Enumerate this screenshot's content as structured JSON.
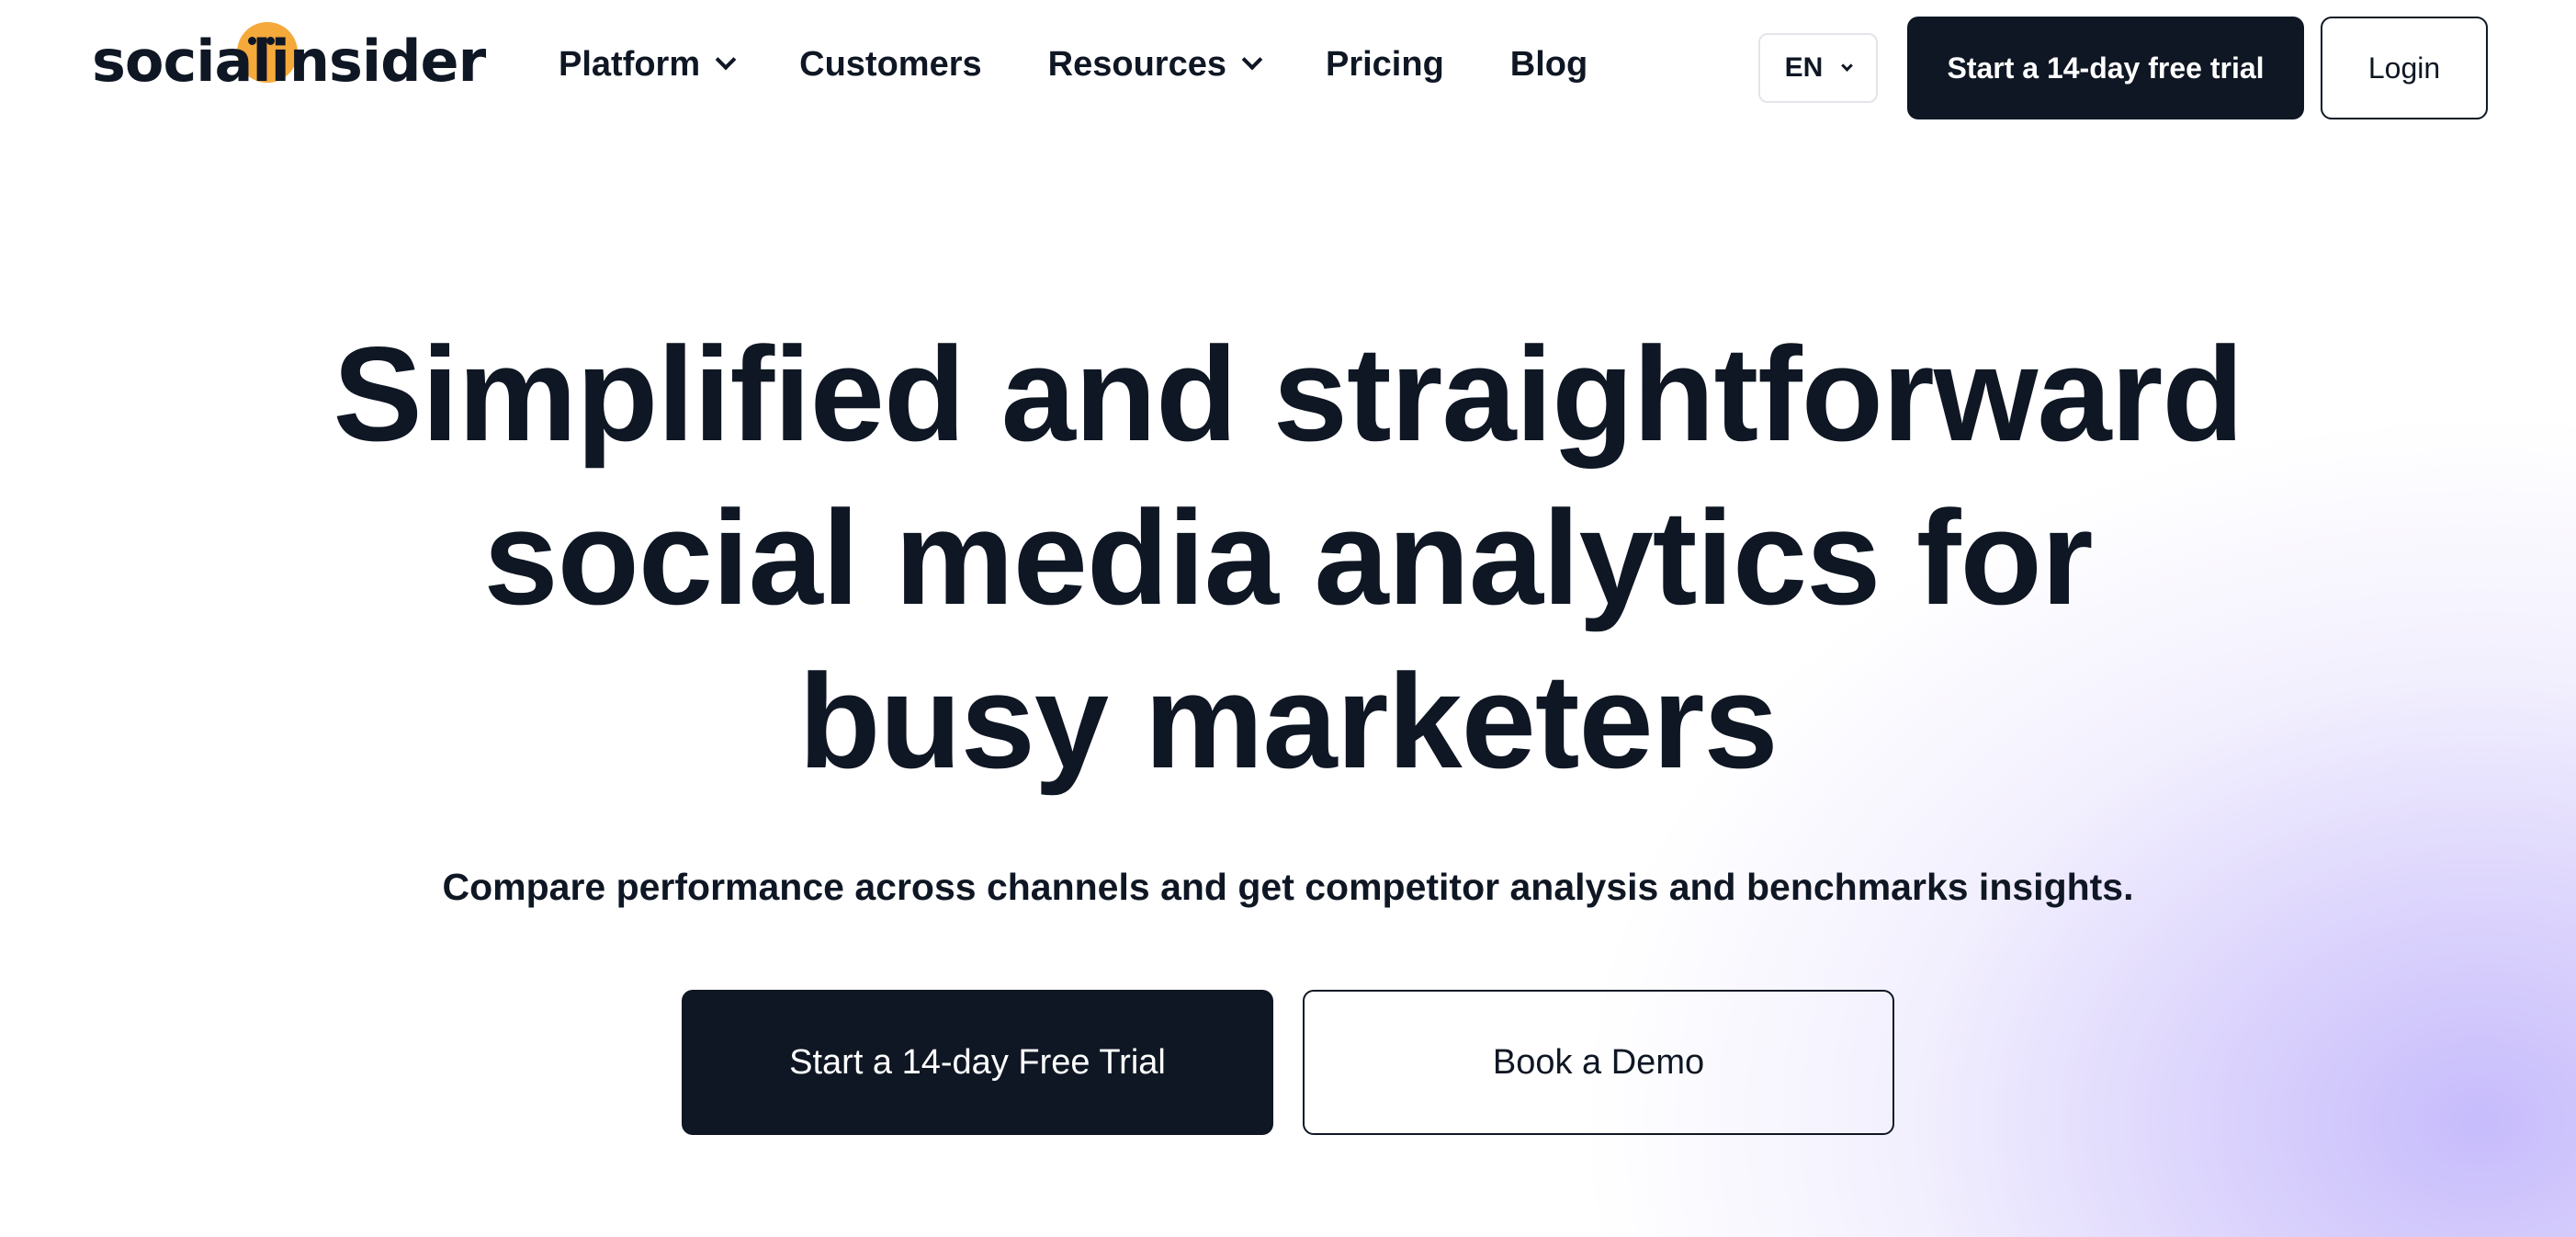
{
  "brand": {
    "logo_text": "socialinsider",
    "accent_color": "#f5a93b",
    "dark_color": "#0f1724",
    "gradient_color": "#c4b8fc"
  },
  "nav": {
    "items": [
      {
        "label": "Platform",
        "has_dropdown": true
      },
      {
        "label": "Customers",
        "has_dropdown": false
      },
      {
        "label": "Resources",
        "has_dropdown": true
      },
      {
        "label": "Pricing",
        "has_dropdown": false
      },
      {
        "label": "Blog",
        "has_dropdown": false
      }
    ]
  },
  "header": {
    "language": "EN",
    "trial_button": "Start a 14-day free trial",
    "login_button": "Login"
  },
  "hero": {
    "title_lines": [
      "Simplified and straightforward",
      "social media analytics for",
      "busy marketers"
    ],
    "subtitle": "Compare performance across channels and get competitor analysis and benchmarks insights.",
    "primary_cta": "Start a 14-day Free Trial",
    "secondary_cta": "Book a Demo"
  }
}
